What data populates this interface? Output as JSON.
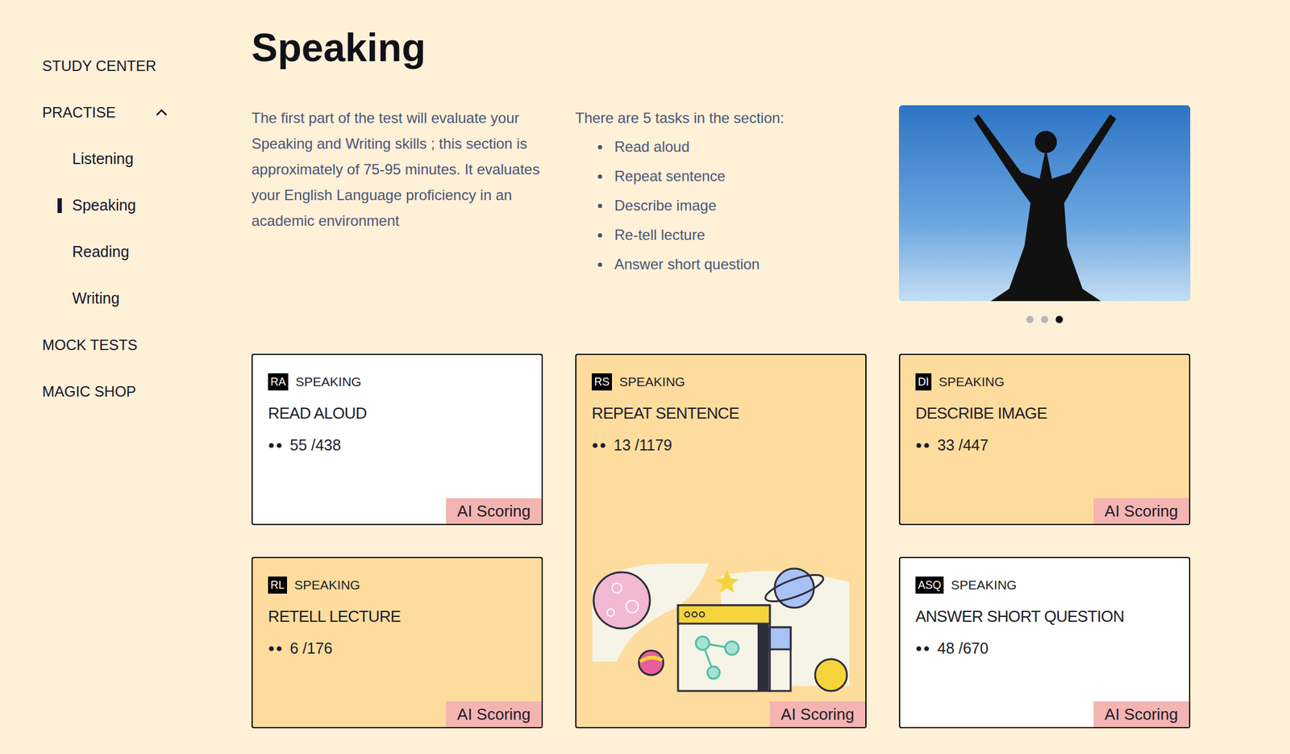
{
  "sidebar": {
    "items": [
      {
        "label": "STUDY CENTER",
        "level": 0,
        "selected": false,
        "expandable": false,
        "expanded": false
      },
      {
        "label": "PRACTISE",
        "level": 0,
        "selected": false,
        "expandable": true,
        "expanded": true
      },
      {
        "label": "Listening",
        "level": 1,
        "selected": false,
        "expandable": false,
        "expanded": false
      },
      {
        "label": "Speaking",
        "level": 1,
        "selected": true,
        "expandable": false,
        "expanded": false
      },
      {
        "label": "Reading",
        "level": 1,
        "selected": false,
        "expandable": false,
        "expanded": false
      },
      {
        "label": "Writing",
        "level": 1,
        "selected": false,
        "expandable": false,
        "expanded": false
      },
      {
        "label": "MOCK TESTS",
        "level": 0,
        "selected": false,
        "expandable": false,
        "expanded": false
      },
      {
        "label": "MAGIC SHOP",
        "level": 0,
        "selected": false,
        "expandable": false,
        "expanded": false
      }
    ]
  },
  "page": {
    "title": "Speaking",
    "description": "The first part of the test will evaluate your Speaking and Writing skills ; this section is approximately of 75-95 minutes. It evaluates your English Language proficiency in an academic environment",
    "tasks_intro": "There are 5 tasks in the section:",
    "tasks": [
      "Read aloud",
      "Repeat sentence",
      "Describe image",
      "Re-tell lecture",
      "Answer short question"
    ]
  },
  "carousel": {
    "dots": [
      {
        "selected": false
      },
      {
        "selected": false
      },
      {
        "selected": true
      }
    ]
  },
  "cards": [
    {
      "kind": "plain",
      "abbr": "RA",
      "category": "SPEAKING",
      "title": "READ ALOUD",
      "marker": "●●",
      "progress": "55 /438",
      "badge": "AI Scoring",
      "color": "#ffffff"
    },
    {
      "kind": "featured",
      "abbr": "RS",
      "category": "SPEAKING",
      "title": "REPEAT SENTENCE",
      "marker": "●●",
      "progress": "13 /1179",
      "badge": "AI Scoring",
      "color": "#fedc9e"
    },
    {
      "kind": "plain",
      "abbr": "DI",
      "category": "SPEAKING",
      "title": "DESCRIBE IMAGE",
      "marker": "●●",
      "progress": "33 /447",
      "badge": "AI Scoring",
      "color": "#fedc9e"
    },
    {
      "kind": "plain",
      "abbr": "RL",
      "category": "SPEAKING",
      "title": "RETELL LECTURE",
      "marker": "●●",
      "progress": "6 /176",
      "badge": "AI Scoring",
      "color": "#fedc9e"
    },
    {
      "kind": "plain",
      "abbr": "ASQ",
      "category": "SPEAKING",
      "title": "ANSWER SHORT QUESTION",
      "marker": "●●",
      "progress": "48 /670",
      "badge": "AI Scoring",
      "color": "#ffffff"
    }
  ]
}
